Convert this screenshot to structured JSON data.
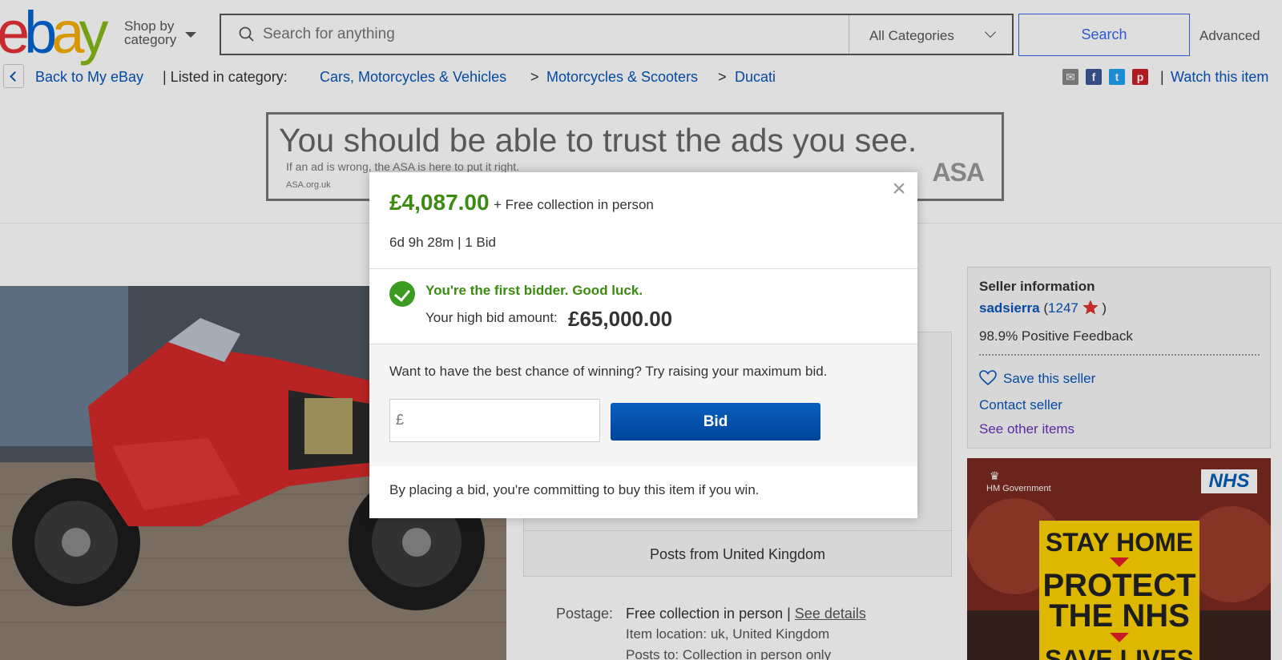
{
  "header": {
    "logo_letters": [
      "e",
      "b",
      "a",
      "y"
    ],
    "logo_colors": [
      "#e53238",
      "#0064d2",
      "#f5af02",
      "#86b817"
    ],
    "shop_by_line1": "Shop by",
    "shop_by_line2": "category",
    "search_placeholder": "Search for anything",
    "category_select": "All Categories",
    "search_button": "Search",
    "advanced_link": "Advanced"
  },
  "breadcrumb": {
    "back_label": "Back to My eBay",
    "listed_label": "| Listed in category:",
    "items": [
      "Cars, Motorcycles & Vehicles",
      "Motorcycles & Scooters",
      "Ducati"
    ],
    "separator": ">",
    "share_icons": [
      "email-icon",
      "facebook-icon",
      "twitter-icon",
      "pinterest-icon"
    ],
    "pipe": "|",
    "watch_label": "Watch this item"
  },
  "ad_banner": {
    "headline": "You should be able to trust the ads you see.",
    "subline": "If an ad is wrong, the ASA is here to put it right.",
    "url": "ASA.org.uk",
    "logo": "ASA"
  },
  "listing": {
    "posts_from": "Posts from United Kingdom",
    "postage_label": "Postage:",
    "postage_value": "Free collection in person |",
    "see_details": "See details",
    "item_location": "Item location: uk, United Kingdom",
    "posts_to": "Posts to: Collection in person only"
  },
  "seller": {
    "heading": "Seller information",
    "username": "sadsierra",
    "feedback_score": "1247",
    "open_paren": "(",
    "close_paren": ")",
    "positive_feedback": "98.9% Positive Feedback",
    "save_seller": "Save this seller",
    "contact_seller": "Contact seller",
    "see_other_items": "See other items"
  },
  "nhs_ad": {
    "gov_label": "HM Government",
    "nhs_logo": "NHS",
    "line1": "STAY HOME",
    "line2a": "PROTECT",
    "line2b": "THE NHS",
    "line3": "SAVE LIVES"
  },
  "modal": {
    "price": "£4,087.00",
    "shipping": "+ Free collection in person",
    "time_left": "6d 9h 28m",
    "time_sep": "|",
    "bids": "1 Bid",
    "status_message": "You're the first bidder. Good luck.",
    "high_bid_label": "Your high bid amount:",
    "high_bid_value": "£65,000.00",
    "raise_prompt": "Want to have the best chance of winning? Try raising your maximum bid.",
    "currency_symbol": "£",
    "bid_input_value": "",
    "bid_button": "Bid",
    "commit_note": "By placing a bid, you're committing to buy this item if you win.",
    "close_symbol": "×"
  },
  "colors": {
    "link": "#0654ba",
    "price_green": "#3a8b0f",
    "bid_blue": "#0654ba",
    "search_blue": "#3665f3"
  }
}
